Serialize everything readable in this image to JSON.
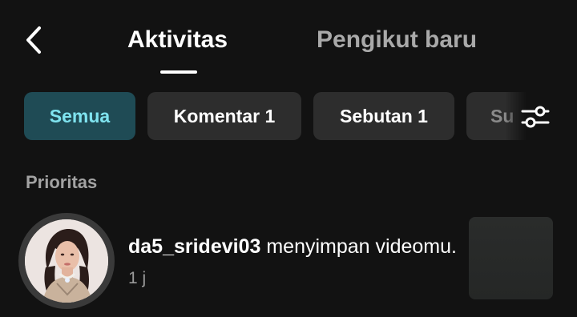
{
  "header": {
    "back_icon": "chevron-left-icon",
    "tabs": [
      {
        "label": "Aktivitas",
        "active": true
      },
      {
        "label": "Pengikut baru",
        "active": false
      }
    ]
  },
  "filters": {
    "chips": [
      {
        "label": "Semua",
        "active": true
      },
      {
        "label": "Komentar 1",
        "active": false
      },
      {
        "label": "Sebutan 1",
        "active": false
      },
      {
        "label": "Su",
        "active": false
      }
    ],
    "filter_icon": "sliders-icon"
  },
  "sections": [
    {
      "title": "Prioritas",
      "items": [
        {
          "username": "da5_sridevi03",
          "action": " menyimpan videomu.",
          "time": " 1 j"
        }
      ]
    }
  ],
  "colors": {
    "background": "#121212",
    "active_chip_bg": "#1f4b55",
    "active_chip_text": "#7fe3ef",
    "chip_bg": "#2d2d2d",
    "muted_text": "#a3a3a3"
  }
}
